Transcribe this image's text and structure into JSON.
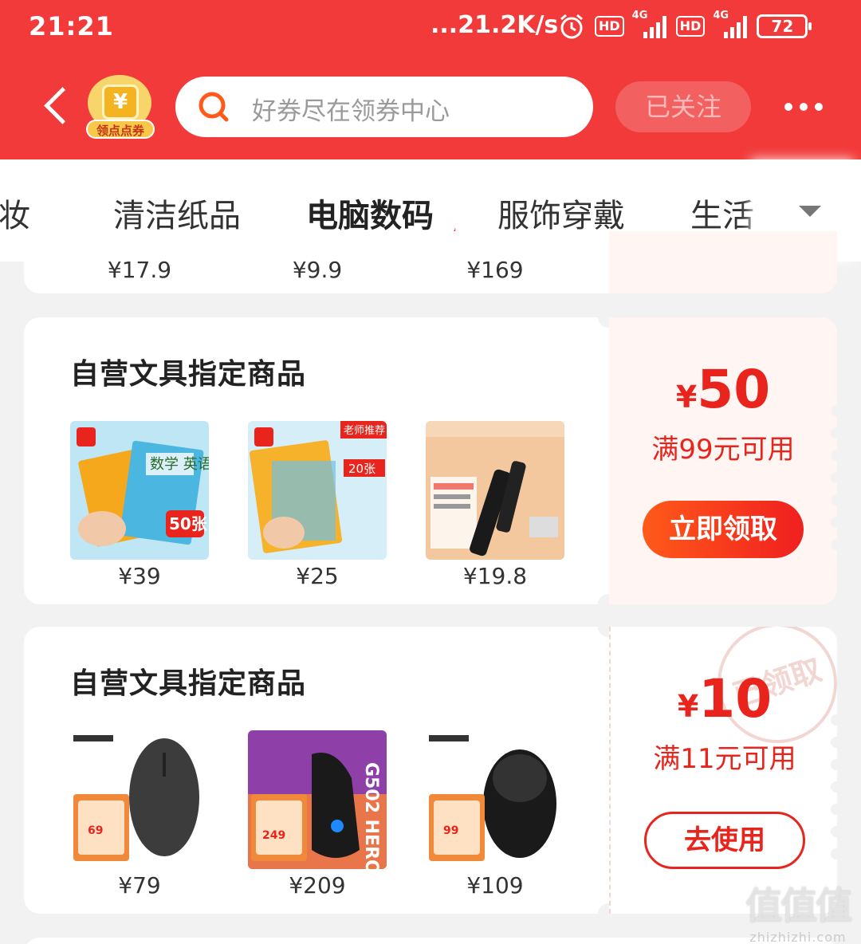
{
  "status_bar": {
    "time": "21:21",
    "speed": "...21.2K/s",
    "hd1": "HD",
    "hd2": "HD",
    "net1": "4G",
    "net2": "4G",
    "battery": "72"
  },
  "header": {
    "badge_symbol": "¥",
    "badge_label": "领点点券",
    "search_placeholder": "好券尽在领券中心",
    "follow_label": "已关注"
  },
  "tabs": [
    "化妆",
    "清洁纸品",
    "电脑数码",
    "服饰穿戴",
    "生活"
  ],
  "active_tab": "电脑数码",
  "top_card_prices": [
    "¥17.9",
    "¥9.9",
    "¥169"
  ],
  "coupons": [
    {
      "title": "自营文具指定商品",
      "products": [
        {
          "price": "¥39",
          "img": "stationery-film-book-covers"
        },
        {
          "price": "¥25",
          "img": "book-cover-film-pack"
        },
        {
          "price": "¥19.8",
          "img": "fountain-pen-set"
        }
      ],
      "amount_symbol": "¥",
      "amount": "50",
      "condition": "满99元可用",
      "button": "立即领取"
    },
    {
      "title": "自营文具指定商品",
      "products": [
        {
          "price": "¥79",
          "img": "logitech-wireless-mouse-gray"
        },
        {
          "price": "¥209",
          "img": "logitech-g502-hero-mouse"
        },
        {
          "price": "¥109",
          "img": "logitech-black-mouse"
        }
      ],
      "amount_symbol": "¥",
      "amount": "10",
      "condition": "满11元可用",
      "button": "去使用",
      "stamp": "已领取"
    }
  ],
  "watermark": {
    "logo": "值值值",
    "url": "zhizhizhi.com"
  },
  "colors": {
    "brand_red": "#f23a3a",
    "coupon_red": "#e8241c"
  }
}
